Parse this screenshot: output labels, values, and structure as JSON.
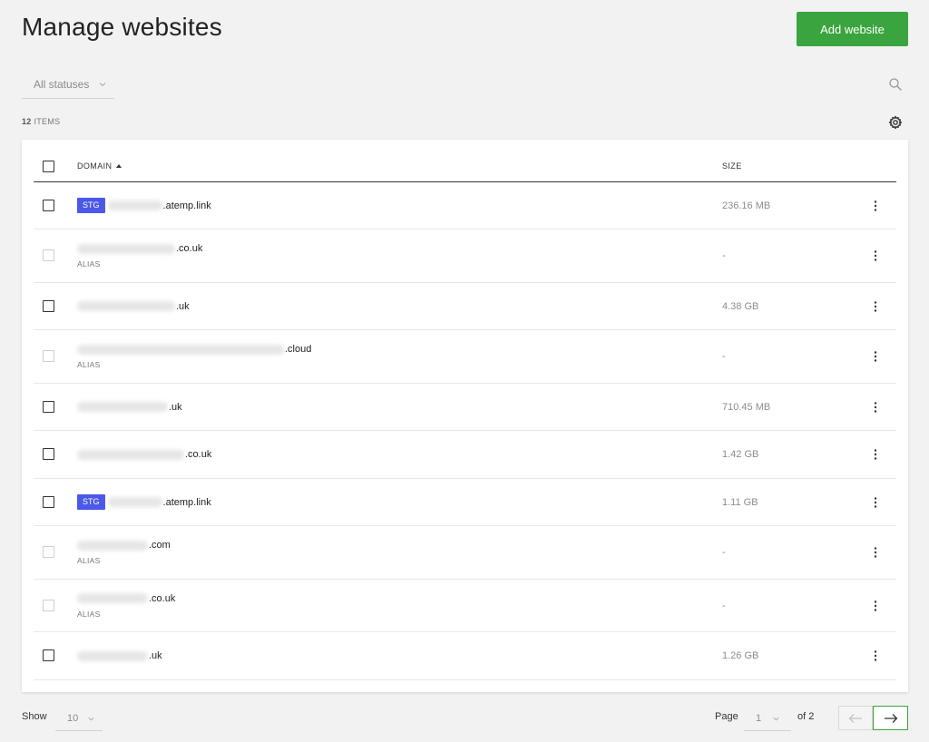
{
  "header": {
    "title": "Manage websites",
    "add_button_label": "Add website"
  },
  "filters": {
    "status_selected": "All statuses"
  },
  "summary": {
    "count": "12",
    "items_label": "ITEMS"
  },
  "table": {
    "columns": {
      "domain": "DOMAIN",
      "size": "SIZE"
    },
    "rows": [
      {
        "badge": "STG",
        "domain_suffix": ".atemp.link",
        "alias": "",
        "size": "236.16 MB",
        "disabled": false,
        "blur_w": 60
      },
      {
        "badge": "",
        "domain_suffix": ".co.uk",
        "alias": "ALIAS",
        "size": "-",
        "disabled": true,
        "blur_w": 108
      },
      {
        "badge": "",
        "domain_suffix": ".uk",
        "alias": "",
        "size": "4.38 GB",
        "disabled": false,
        "blur_w": 108
      },
      {
        "badge": "",
        "domain_suffix": ".cloud",
        "alias": "ALIAS",
        "size": "-",
        "disabled": true,
        "blur_w": 228
      },
      {
        "badge": "",
        "domain_suffix": ".uk",
        "alias": "",
        "size": "710.45 MB",
        "disabled": false,
        "blur_w": 100
      },
      {
        "badge": "",
        "domain_suffix": ".co.uk",
        "alias": "",
        "size": "1.42 GB",
        "disabled": false,
        "blur_w": 118
      },
      {
        "badge": "STG",
        "domain_suffix": ".atemp.link",
        "alias": "",
        "size": "1.11 GB",
        "disabled": false,
        "blur_w": 60
      },
      {
        "badge": "",
        "domain_suffix": ".com",
        "alias": "ALIAS",
        "size": "-",
        "disabled": true,
        "blur_w": 78
      },
      {
        "badge": "",
        "domain_suffix": ".co.uk",
        "alias": "ALIAS",
        "size": "-",
        "disabled": true,
        "blur_w": 78
      },
      {
        "badge": "",
        "domain_suffix": ".uk",
        "alias": "",
        "size": "1.26 GB",
        "disabled": false,
        "blur_w": 78
      }
    ]
  },
  "pagination": {
    "show_label": "Show",
    "page_size": "10",
    "page_label": "Page",
    "current_page": "1",
    "of_label": "of 2"
  },
  "colors": {
    "accent_green": "#3aa43f",
    "staging_badge": "#4b58e8"
  },
  "icons": [
    "search-icon",
    "gear-icon",
    "chevron-down-icon",
    "sort-ascending-icon",
    "kebab-menu-icon",
    "arrow-left-icon",
    "arrow-right-icon"
  ]
}
